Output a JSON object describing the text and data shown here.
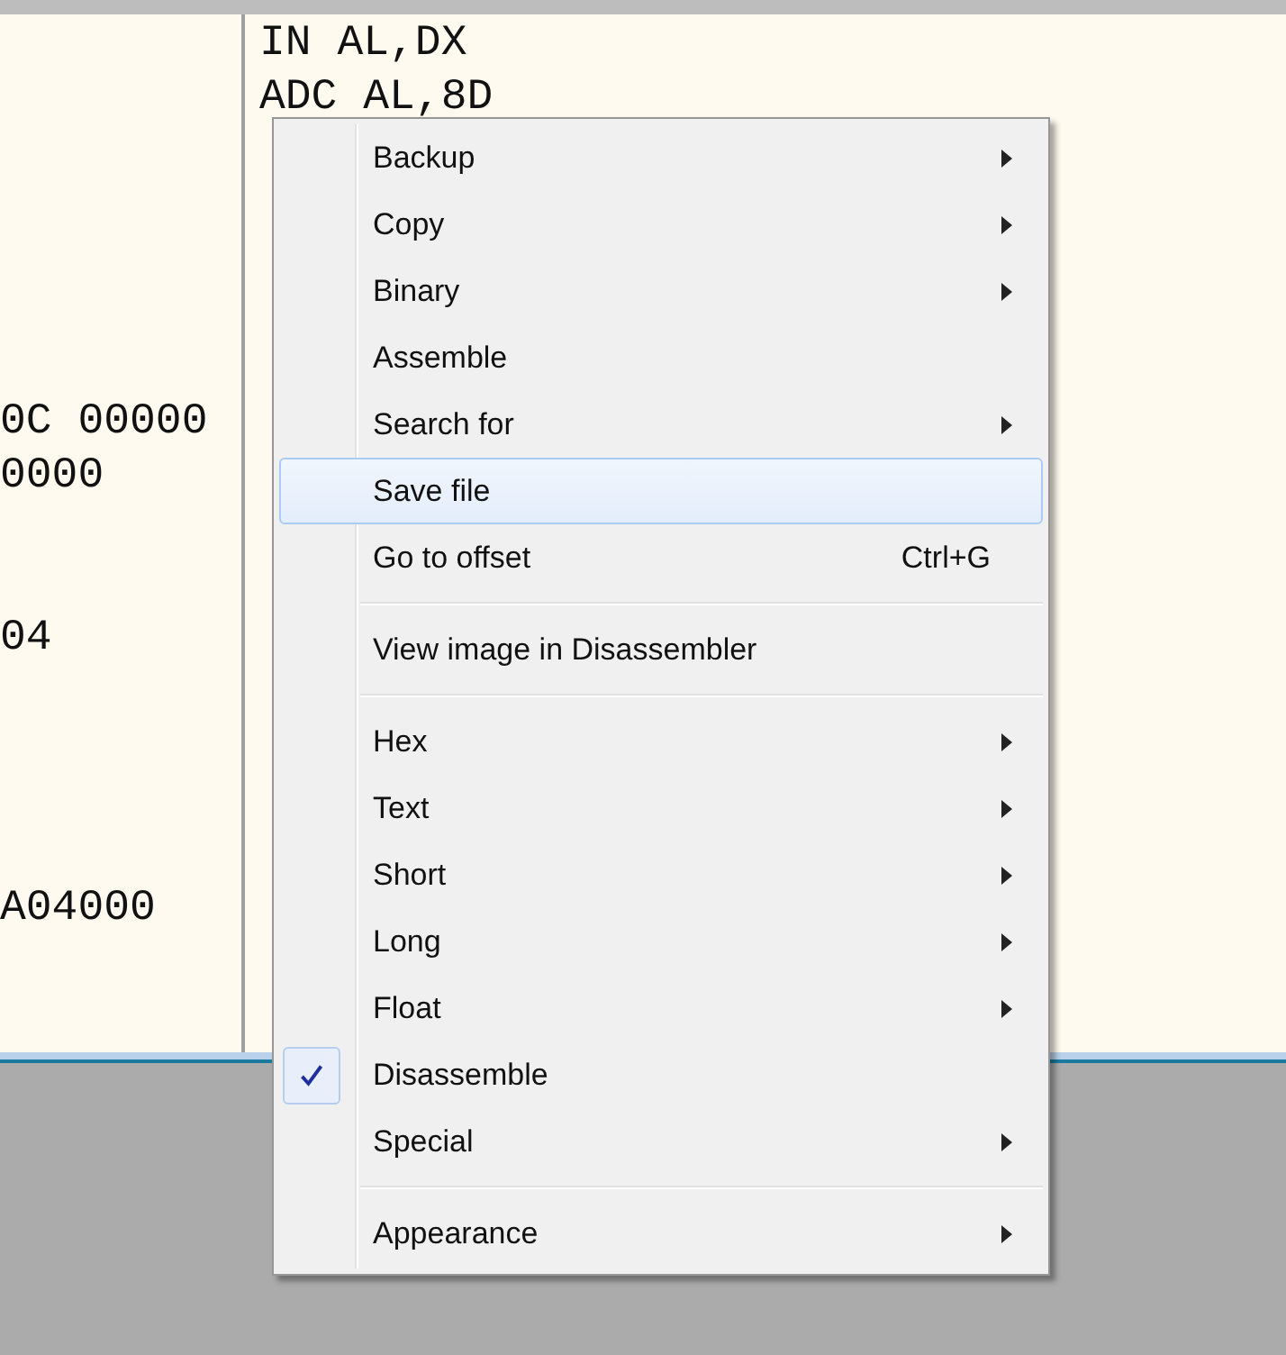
{
  "code_view": {
    "rows": [
      {
        "column_2": "IN AL,DX"
      },
      {
        "column_2": "ADC AL,8D"
      },
      {},
      {},
      {},
      {},
      {},
      {
        "column_1": "0C 00000"
      },
      {
        "column_1": "0000"
      },
      {},
      {},
      {
        "column_1": "04"
      },
      {},
      {},
      {},
      {},
      {
        "column_1": "A04000"
      },
      {},
      {}
    ]
  },
  "context_menu": {
    "items": [
      {
        "kind": "item",
        "label": "Backup",
        "submenu": true,
        "checked": false,
        "selected": false
      },
      {
        "kind": "item",
        "label": "Copy",
        "submenu": true,
        "checked": false,
        "selected": false
      },
      {
        "kind": "item",
        "label": "Binary",
        "submenu": true,
        "checked": false,
        "selected": false
      },
      {
        "kind": "item",
        "label": "Assemble",
        "submenu": false,
        "checked": false,
        "selected": false
      },
      {
        "kind": "item",
        "label": "Search for",
        "submenu": true,
        "checked": false,
        "selected": false
      },
      {
        "kind": "item",
        "label": "Save file",
        "submenu": false,
        "checked": false,
        "selected": true
      },
      {
        "kind": "item",
        "label": "Go to offset",
        "shortcut": "Ctrl+G",
        "submenu": false,
        "checked": false,
        "selected": false
      },
      {
        "kind": "separator"
      },
      {
        "kind": "item",
        "label": "View image in Disassembler",
        "submenu": false,
        "checked": false,
        "selected": false
      },
      {
        "kind": "separator"
      },
      {
        "kind": "item",
        "label": "Hex",
        "submenu": true,
        "checked": false,
        "selected": false
      },
      {
        "kind": "item",
        "label": "Text",
        "submenu": true,
        "checked": false,
        "selected": false
      },
      {
        "kind": "item",
        "label": "Short",
        "submenu": true,
        "checked": false,
        "selected": false
      },
      {
        "kind": "item",
        "label": "Long",
        "submenu": true,
        "checked": false,
        "selected": false
      },
      {
        "kind": "item",
        "label": "Float",
        "submenu": true,
        "checked": false,
        "selected": false
      },
      {
        "kind": "item",
        "label": "Disassemble",
        "submenu": false,
        "checked": true,
        "selected": false
      },
      {
        "kind": "item",
        "label": "Special",
        "submenu": true,
        "checked": false,
        "selected": false
      },
      {
        "kind": "separator"
      },
      {
        "kind": "item",
        "label": "Appearance",
        "submenu": true,
        "checked": false,
        "selected": false
      }
    ]
  }
}
